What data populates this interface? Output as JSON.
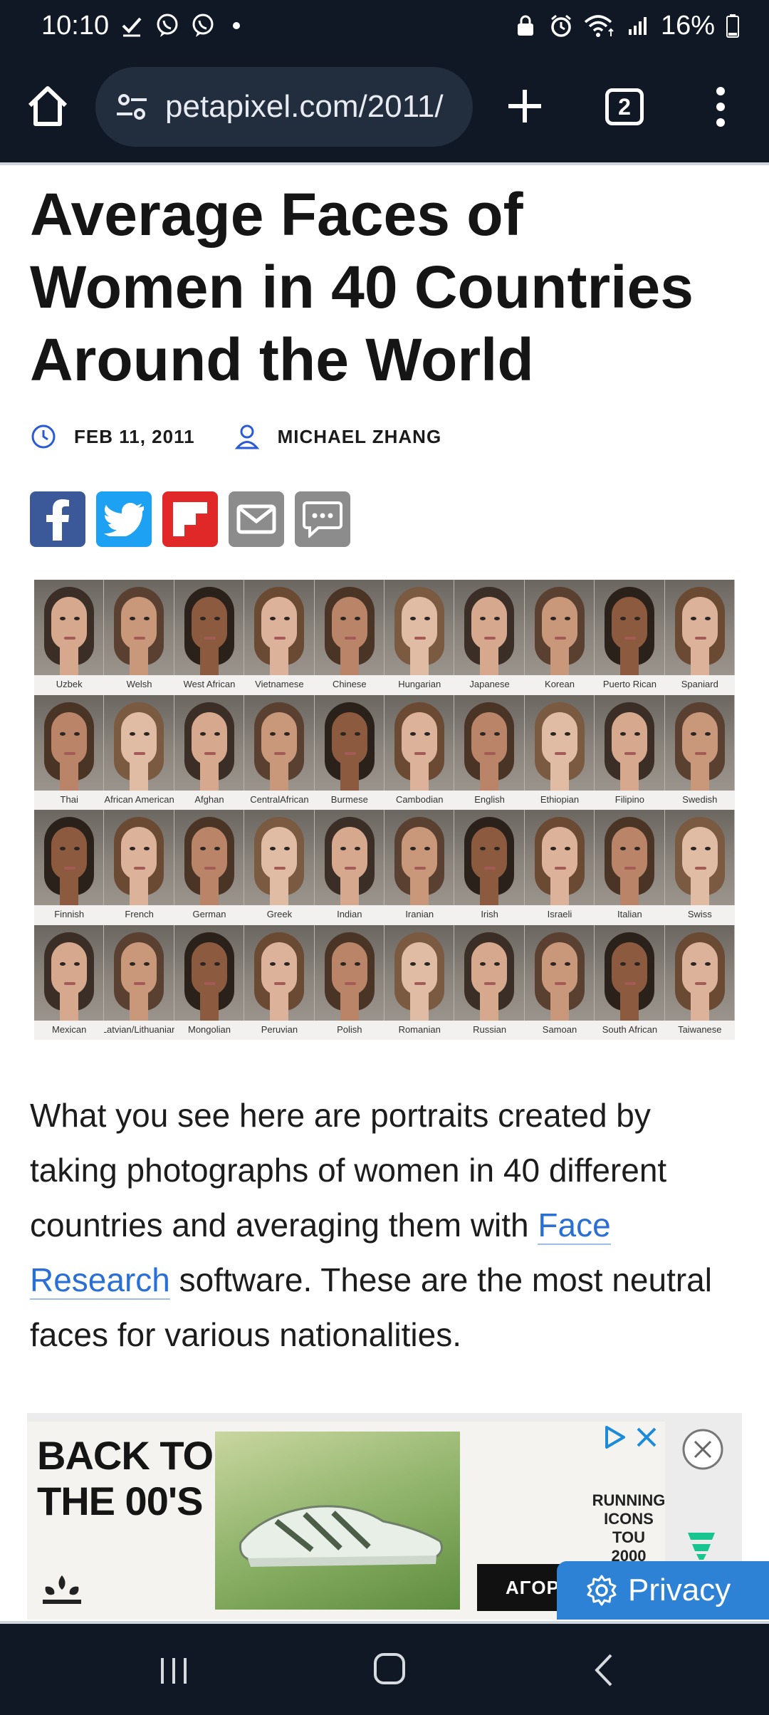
{
  "status_bar": {
    "time": "10:10",
    "battery": "16%",
    "left_icons": [
      "check-icon",
      "viber-icon",
      "viber-icon",
      "dot-icon"
    ],
    "right_icons": [
      "vpn-lock-icon",
      "alarm-icon",
      "wifi-icon",
      "signal-icon",
      "battery-icon"
    ]
  },
  "browser": {
    "url": "petapixel.com/2011/",
    "tab_count": "2"
  },
  "article": {
    "title": "Average Faces of Women in 40 Countries Around the World",
    "date": "FEB 11, 2011",
    "author": "MICHAEL ZHANG",
    "share_buttons": [
      "facebook",
      "twitter",
      "flipboard",
      "email",
      "comments"
    ],
    "faces": [
      "Uzbek",
      "Welsh",
      "West African",
      "Vietnamese",
      "Chinese",
      "Hungarian",
      "Japanese",
      "Korean",
      "Puerto Rican",
      "Spaniard",
      "Thai",
      "African American",
      "Afghan",
      "CentralAfrican",
      "Burmese",
      "Cambodian",
      "English",
      "Ethiopian",
      "Filipino",
      "Swedish",
      "Finnish",
      "French",
      "German",
      "Greek",
      "Indian",
      "Iranian",
      "Irish",
      "Israeli",
      "Italian",
      "Swiss",
      "Mexican",
      "Latvian/Lithuanian",
      "Mongolian",
      "Peruvian",
      "Polish",
      "Romanian",
      "Russian",
      "Samoan",
      "South African",
      "Taiwanese"
    ],
    "paragraph_before": "What you see here are portraits created by taking photographs of women in 40 different countries and averaging them with ",
    "paragraph_link": "Face Research",
    "paragraph_after": " software. These are the most neutral faces for various nationalities."
  },
  "ad": {
    "headline_line1": "BACK TO",
    "headline_line2": "THE 00'S",
    "side_line1": "RUNNING",
    "side_line2": "ICONS TOU",
    "side_line3": "2000",
    "cta": "ΑΓΟΡ"
  },
  "privacy_label": "Privacy",
  "colors": {
    "chrome_bg": "#101826",
    "url_pill": "#222d3e",
    "link": "#2a6fd6",
    "privacy": "#2e82d6"
  }
}
